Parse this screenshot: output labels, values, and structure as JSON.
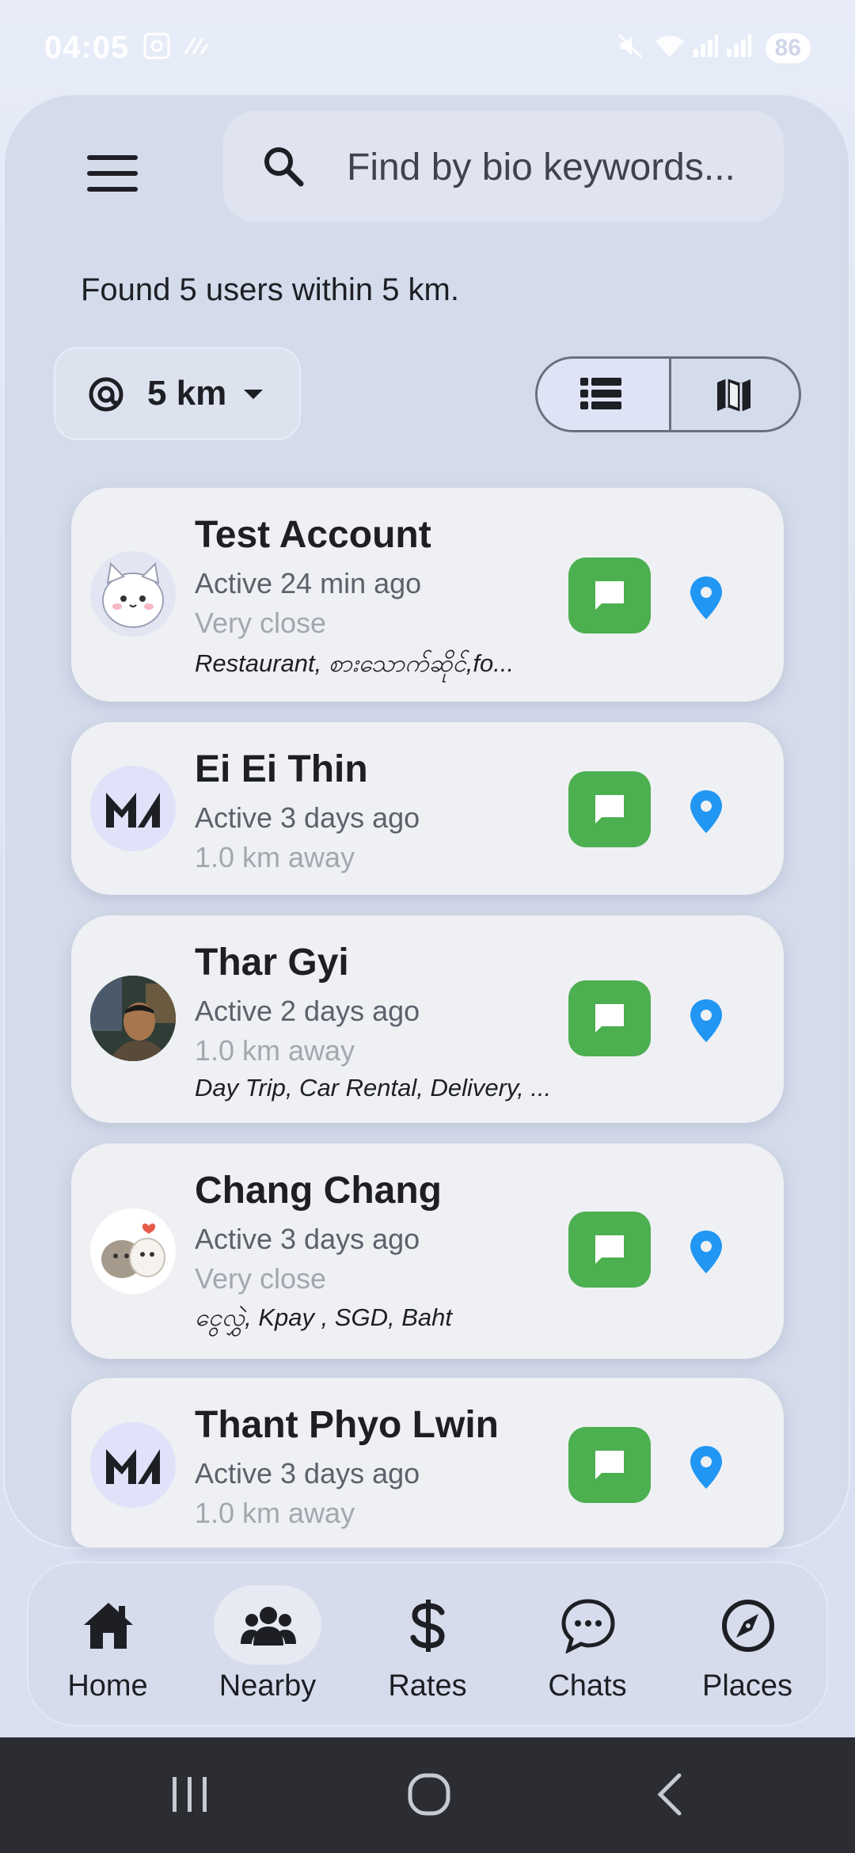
{
  "status_bar": {
    "time": "04:05",
    "battery": "86"
  },
  "search": {
    "placeholder": "Find by bio keywords..."
  },
  "summary": "Found 5 users within 5 km.",
  "radius": {
    "value": "5 km"
  },
  "view_toggle": {
    "options": [
      "list-icon",
      "map-icon"
    ],
    "selected": "list"
  },
  "users": [
    {
      "name": "Test Account",
      "active": "Active 24 min ago",
      "distance": "Very close",
      "tags": "Restaurant, စားသောက်ဆိုင်,fo..."
    },
    {
      "name": "Ei Ei Thin",
      "active": "Active 3 days ago",
      "distance": "1.0 km away",
      "tags": ""
    },
    {
      "name": "Thar Gyi",
      "active": "Active 2 days ago",
      "distance": "1.0 km away",
      "tags": "Day Trip, Car Rental, Delivery, ..."
    },
    {
      "name": "Chang Chang",
      "active": "Active 3 days ago",
      "distance": "Very close",
      "tags": "ငွေလွှဲ, Kpay , SGD, Baht"
    },
    {
      "name": "Thant Phyo Lwin",
      "active": "Active 3 days ago",
      "distance": "1.0 km away",
      "tags": ""
    }
  ],
  "nav": {
    "items": [
      {
        "label": "Home",
        "icon": "home-icon"
      },
      {
        "label": "Nearby",
        "icon": "people-icon"
      },
      {
        "label": "Rates",
        "icon": "dollar-icon"
      },
      {
        "label": "Chats",
        "icon": "chat-bubble-icon"
      },
      {
        "label": "Places",
        "icon": "compass-icon"
      }
    ],
    "active": "Nearby"
  },
  "colors": {
    "chat_button": "#4caf50",
    "pin": "#2196f3",
    "background": "#d4dbeb"
  }
}
